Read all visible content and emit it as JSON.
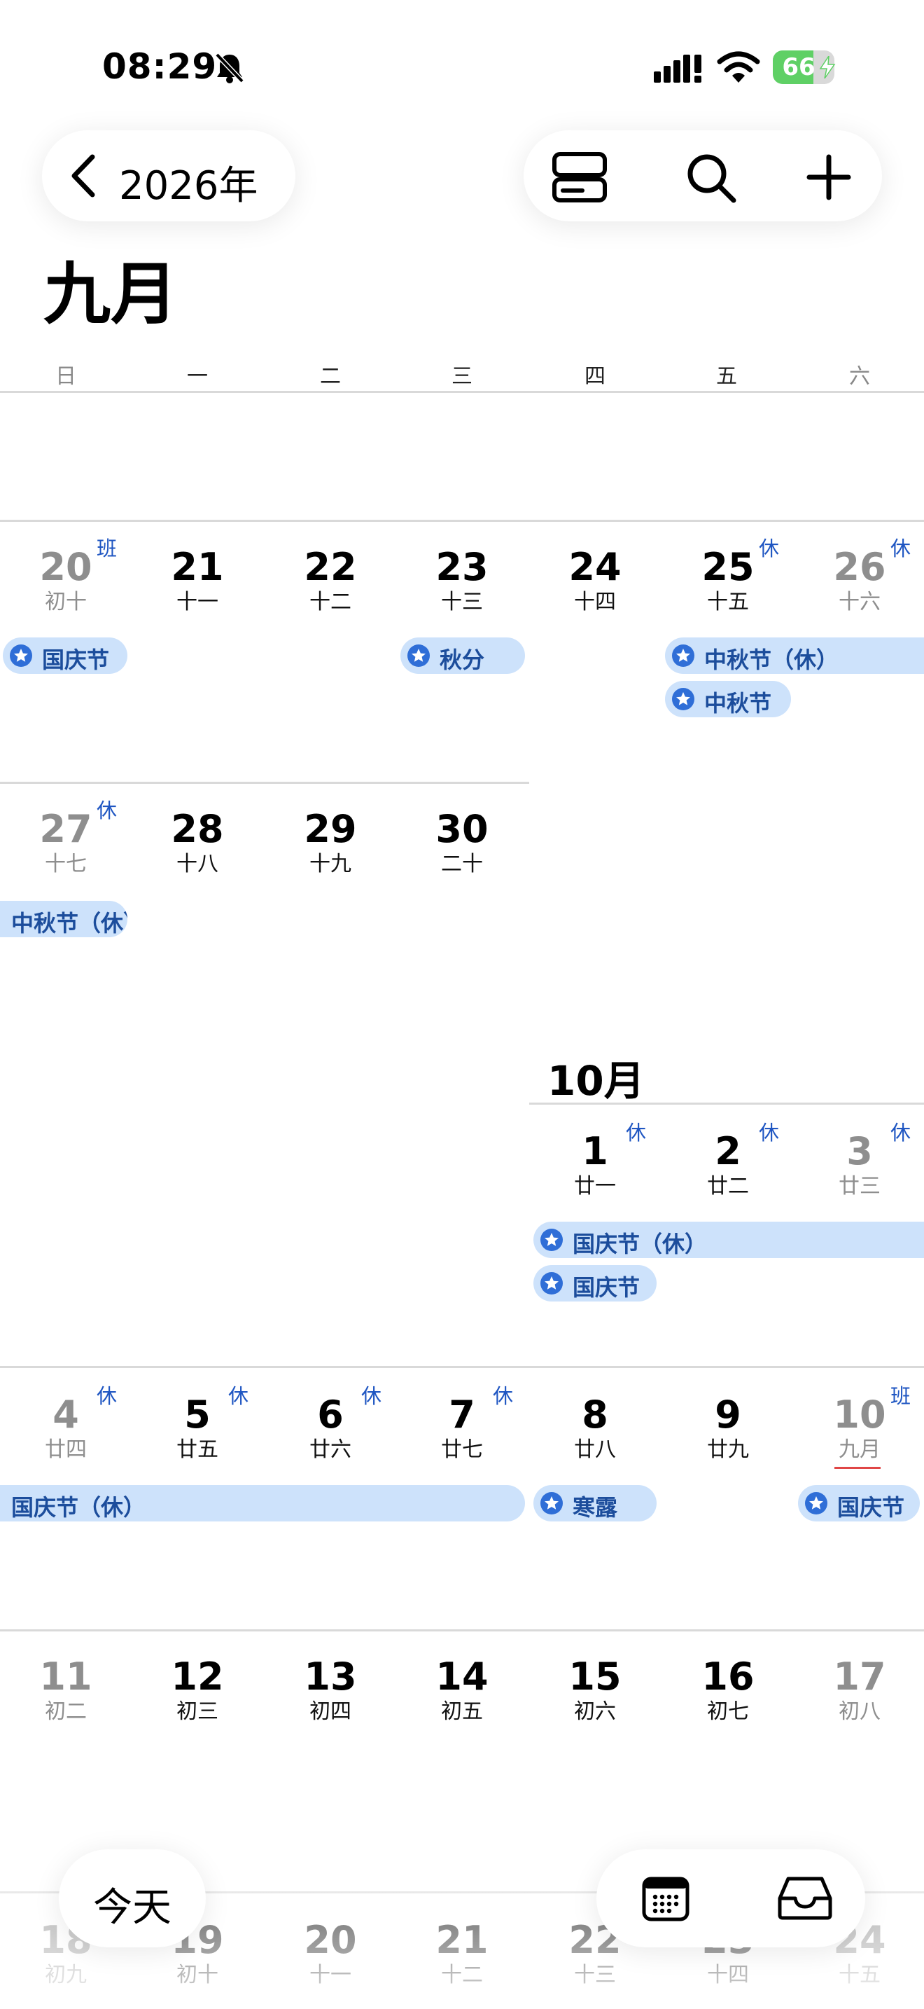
{
  "status": {
    "time": "08:29",
    "battery": "66",
    "battery_level": 0.66
  },
  "nav": {
    "back_label": "2026年"
  },
  "month": {
    "title": "九月"
  },
  "weekdays": [
    "日",
    "一",
    "二",
    "三",
    "四",
    "五",
    "六"
  ],
  "week1": {
    "days": [
      {
        "num": "20",
        "lunar": "初十",
        "badge": "班"
      },
      {
        "num": "21",
        "lunar": "十一"
      },
      {
        "num": "22",
        "lunar": "十二"
      },
      {
        "num": "23",
        "lunar": "十三"
      },
      {
        "num": "24",
        "lunar": "十四"
      },
      {
        "num": "25",
        "lunar": "十五",
        "badge": "休"
      },
      {
        "num": "26",
        "lunar": "十六",
        "badge": "休"
      }
    ],
    "events": [
      "国庆节",
      "秋分",
      "中秋节（休）",
      "中秋节"
    ]
  },
  "week2": {
    "days": [
      {
        "num": "27",
        "lunar": "十七",
        "badge": "休"
      },
      {
        "num": "28",
        "lunar": "十八"
      },
      {
        "num": "29",
        "lunar": "十九"
      },
      {
        "num": "30",
        "lunar": "二十"
      }
    ],
    "events": [
      "中秋节（休）"
    ]
  },
  "october": {
    "title": "10月",
    "days": [
      {
        "num": "1",
        "lunar": "廿一",
        "badge": "休"
      },
      {
        "num": "2",
        "lunar": "廿二",
        "badge": "休"
      },
      {
        "num": "3",
        "lunar": "廿三",
        "badge": "休"
      }
    ],
    "events": [
      "国庆节（休）",
      "国庆节"
    ]
  },
  "week4": {
    "days": [
      {
        "num": "4",
        "lunar": "廿四",
        "badge": "休"
      },
      {
        "num": "5",
        "lunar": "廿五",
        "badge": "休"
      },
      {
        "num": "6",
        "lunar": "廿六",
        "badge": "休"
      },
      {
        "num": "7",
        "lunar": "廿七",
        "badge": "休"
      },
      {
        "num": "8",
        "lunar": "廿八"
      },
      {
        "num": "9",
        "lunar": "廿九"
      },
      {
        "num": "10",
        "lunar": "九月",
        "badge": "班"
      }
    ],
    "events": [
      "国庆节（休）",
      "寒露",
      "国庆节"
    ]
  },
  "week5": {
    "days": [
      {
        "num": "11",
        "lunar": "初二"
      },
      {
        "num": "12",
        "lunar": "初三"
      },
      {
        "num": "13",
        "lunar": "初四"
      },
      {
        "num": "14",
        "lunar": "初五"
      },
      {
        "num": "15",
        "lunar": "初六"
      },
      {
        "num": "16",
        "lunar": "初七"
      },
      {
        "num": "17",
        "lunar": "初八"
      }
    ]
  },
  "week6": {
    "days": [
      {
        "num": "18",
        "lunar": "初九"
      },
      {
        "num": "19",
        "lunar": "初十"
      },
      {
        "num": "20",
        "lunar": "十一"
      },
      {
        "num": "21",
        "lunar": "十二"
      },
      {
        "num": "22",
        "lunar": "十三"
      },
      {
        "num": "23",
        "lunar": "十四"
      },
      {
        "num": "24",
        "lunar": "十五"
      }
    ]
  },
  "bottom": {
    "today_label": "今天"
  },
  "icons": {
    "bell": "bell-slash-icon",
    "signal": "cellular-signal-icon",
    "wifi": "wifi-icon",
    "battery": "battery-icon",
    "back": "chevron-left-icon",
    "view": "view-toggle-icon",
    "search": "search-icon",
    "add": "plus-icon",
    "calendar": "calendar-icon",
    "inbox": "inbox-icon",
    "event": "star-circle-icon"
  },
  "colors": {
    "event_bg": "#cde2fb",
    "event_text": "#1c4d9c",
    "badge": "#1f56c2",
    "battery_fill": "#5fd065"
  }
}
